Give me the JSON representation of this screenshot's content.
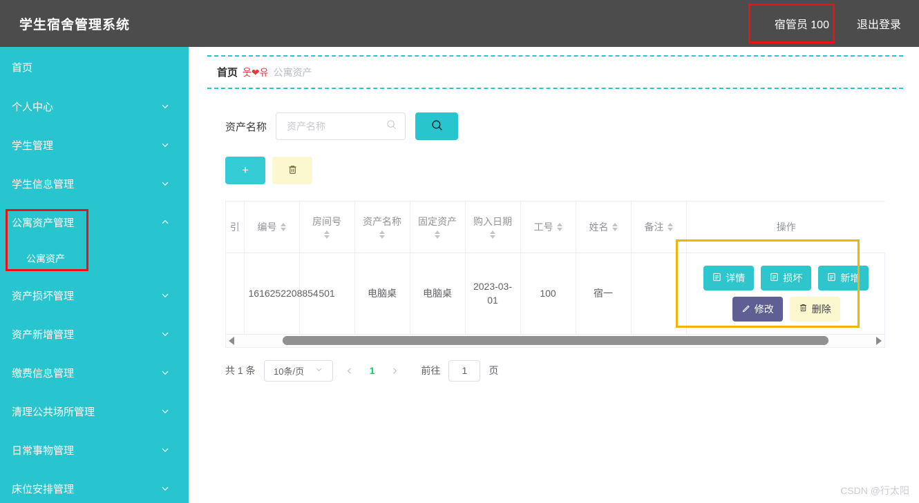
{
  "app": {
    "brand": "学生宿舍管理系统",
    "watermark": "CSDN @行太阳",
    "colors": {
      "topbar_bg": "#4c4c4c",
      "sidebar_bg": "#29c5ce",
      "accent_teal": "#29c5ce",
      "accent_purple": "#5f5f93",
      "accent_yellow": "#fbf8d0",
      "annotation_red": "#ee1111",
      "annotation_yellow": "#f5b301",
      "page_active_green": "#13ce66"
    }
  },
  "topbar": {
    "user_label": "宿管员 100",
    "logout_label": "退出登录"
  },
  "sidebar": {
    "items": [
      {
        "label": "首页",
        "icon": "",
        "expandable": false,
        "expanded": false
      },
      {
        "label": "个人中心",
        "icon": "chevron-down-icon",
        "expandable": true,
        "expanded": false
      },
      {
        "label": "学生管理",
        "icon": "chevron-down-icon",
        "expandable": true,
        "expanded": false
      },
      {
        "label": "学生信息管理",
        "icon": "chevron-down-icon",
        "expandable": true,
        "expanded": false
      },
      {
        "label": "公寓资产管理",
        "icon": "chevron-up-icon",
        "expandable": true,
        "expanded": true
      },
      {
        "label": "资产损坏管理",
        "icon": "chevron-down-icon",
        "expandable": true,
        "expanded": false
      },
      {
        "label": "资产新增管理",
        "icon": "chevron-down-icon",
        "expandable": true,
        "expanded": false
      },
      {
        "label": "缴费信息管理",
        "icon": "chevron-down-icon",
        "expandable": true,
        "expanded": false
      },
      {
        "label": "清理公共场所管理",
        "icon": "chevron-down-icon",
        "expandable": true,
        "expanded": false
      },
      {
        "label": "日常事物管理",
        "icon": "chevron-down-icon",
        "expandable": true,
        "expanded": false
      },
      {
        "label": "床位安排管理",
        "icon": "chevron-down-icon",
        "expandable": true,
        "expanded": false
      }
    ],
    "submenu": {
      "label": "公寓资产"
    }
  },
  "breadcrumb": {
    "home": "首页",
    "separator": "웃❤유",
    "current": "公寓资产"
  },
  "search": {
    "label": "资产名称",
    "placeholder": "资产名称",
    "value": "",
    "input_icon": "search-icon",
    "button_icon": "search-icon"
  },
  "toolbar": {
    "add_label": "+",
    "add_icon": "plus-icon",
    "delete_icon": "trash-icon"
  },
  "table": {
    "columns": [
      {
        "label": "引",
        "sortable": false,
        "stacked": false
      },
      {
        "label": "编号",
        "sortable": true,
        "stacked": false
      },
      {
        "label": "房间号",
        "sortable": true,
        "stacked": true
      },
      {
        "label": "资产名称",
        "sortable": true,
        "stacked": true
      },
      {
        "label": "固定资产",
        "sortable": true,
        "stacked": true
      },
      {
        "label": "购入日期",
        "sortable": true,
        "stacked": true
      },
      {
        "label": "工号",
        "sortable": true,
        "stacked": false
      },
      {
        "label": "姓名",
        "sortable": true,
        "stacked": false
      },
      {
        "label": "备注",
        "sortable": true,
        "stacked": false
      },
      {
        "label": "操作",
        "sortable": false,
        "stacked": false
      }
    ],
    "rows": [
      {
        "index": "",
        "number": "1616252208854",
        "room": "501",
        "asset_name": "电脑桌",
        "fixed_asset": "电脑桌",
        "purchase_date": "2023-03-01",
        "staff_id": "100",
        "staff_name": "宿一",
        "remark": ""
      }
    ],
    "actions": [
      {
        "label": "详情",
        "icon": "document-icon",
        "style": "teal"
      },
      {
        "label": "损坏",
        "icon": "document-icon",
        "style": "teal"
      },
      {
        "label": "新增",
        "icon": "document-icon",
        "style": "teal"
      },
      {
        "label": "修改",
        "icon": "edit-icon",
        "style": "purple"
      },
      {
        "label": "删除",
        "icon": "trash-icon",
        "style": "yellow"
      }
    ]
  },
  "pagination": {
    "total_text": "共 1 条",
    "page_size": "10条/页",
    "prev_icon": "chevron-left-icon",
    "next_icon": "chevron-right-icon",
    "current_page": "1",
    "goto_label": "前往",
    "goto_value": "1",
    "page_unit": "页"
  }
}
